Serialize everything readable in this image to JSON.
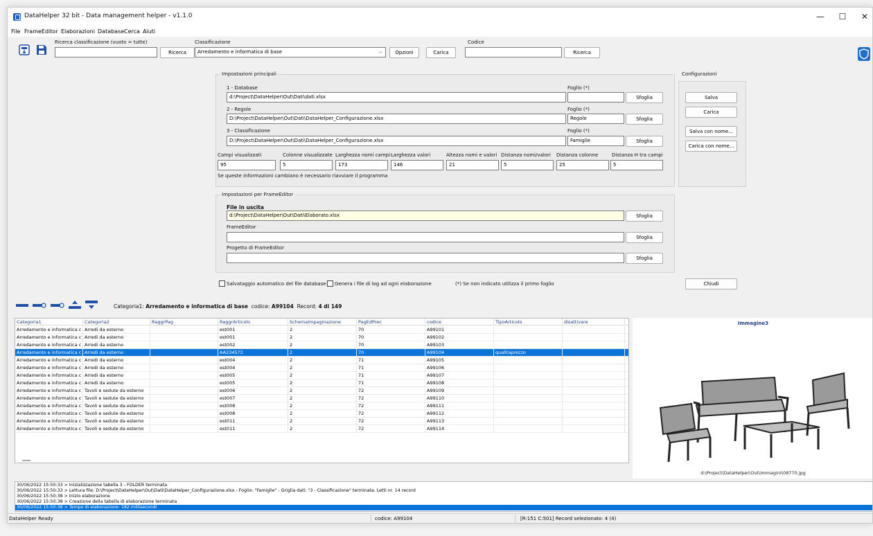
{
  "window": {
    "title": "DataHelper 32 bit - Data management helper - v1.1.0",
    "min": "—",
    "max": "☐",
    "close": "✕"
  },
  "menu": [
    "File",
    "FrameEditor",
    "Elaborazioni",
    "Database",
    "Cerca",
    "Aiuti"
  ],
  "search": {
    "class_label": "Ricerca classificazione (vuoto = tutte)",
    "class_value": "",
    "search_btn": "Ricerca",
    "classification_label": "Classificazione",
    "classification_value": "Arredamento e informatica di base",
    "options_btn": "Opzioni",
    "load_btn": "Carica",
    "code_label": "Codice",
    "code_value": "",
    "code_search_btn": "Ricerca"
  },
  "main_settings": {
    "title": "Impostazioni principali",
    "db_label": "1 - Database",
    "db_value": "d:\\Project\\DataHelper\\Out\\Dati\\dati.xlsx",
    "db_sheet": "",
    "rules_label": "2 - Regole",
    "rules_value": "D:\\Project\\DataHelper\\Out\\Dati\\DataHelper_Configurazione.xlsx",
    "rules_sheet": "Regole",
    "class_label": "3 - Classificazione",
    "class_value": "D:\\Project\\DataHelper\\Out\\Dati\\DataHelper_Configurazione.xlsx",
    "class_sheet": "Famiglie",
    "sheet_label": "Foglio (*)",
    "browse": "Sfoglia",
    "params": [
      {
        "label": "Campi visualizzati",
        "value": "95"
      },
      {
        "label": "Colonne visualizzate",
        "value": "5"
      },
      {
        "label": "Larghezza nomi campi",
        "value": "173"
      },
      {
        "label": "Larghezza valori",
        "value": "146"
      },
      {
        "label": "Altezza nomi e valori",
        "value": "21"
      },
      {
        "label": "Distanza nomi/valori",
        "value": "5"
      },
      {
        "label": "Distanza colonne",
        "value": "25"
      },
      {
        "label": "Distanza H tra campi",
        "value": "5"
      }
    ],
    "restart_note": "Se queste informazioni cambiano è necessario riavviare il programma"
  },
  "config": {
    "title": "Configurazioni",
    "save": "Salva",
    "load": "Carica",
    "save_as": "Salva con nome...",
    "load_as": "Carica con nome..."
  },
  "frameeditor": {
    "title": "Impostazioni per FrameEditor",
    "out_label": "File in uscita",
    "out_value": "d:\\Project\\DataHelper\\Out\\Dati\\Elaborato.xlsx",
    "fe_label": "FrameEditor",
    "fe_value": "",
    "proj_label": "Progetto di FrameEditor",
    "proj_value": "",
    "browse": "Sfoglia"
  },
  "options": {
    "autosave": "Salvataggio automatico del file database",
    "logfile": "Genera i file di log ad ogni elaborazione",
    "note": "(*) Se non indicato utilizza il primo foglio",
    "close_btn": "Chiudi"
  },
  "record_bar": {
    "cat_label": "Categoria1:",
    "cat_value": "Arredamento e informatica di base",
    "code_label": "codice:",
    "code_value": "A99104",
    "rec_label": "Record:",
    "rec_value": "4 di 149"
  },
  "grid": {
    "columns": [
      "Categoria1",
      "Categoria2",
      "RaggrPag",
      "RaggrArticolo",
      "SchemaImpaginazione",
      "PagEdPrec",
      "codice",
      "TipoArticolo",
      "disattivare"
    ],
    "rows": [
      [
        "Arredamento e informatica c",
        "Arredi da esterno",
        "",
        "est001",
        "2",
        "70",
        "A99101",
        "",
        ""
      ],
      [
        "Arredamento e informatica c",
        "Arredi da esterno",
        "",
        "est001",
        "2",
        "70",
        "A99102",
        "",
        ""
      ],
      [
        "Arredamento e informatica c",
        "Arredi da esterno",
        "",
        "est002",
        "2",
        "70",
        "A99103",
        "",
        ""
      ],
      [
        "Arredamento e informatica c",
        "Arredi da esterno",
        "",
        "AA2345?3",
        "2",
        "70",
        "A99104",
        "qualitaprezzo",
        ""
      ],
      [
        "Arredamento e informatica c",
        "Arredi da esterno",
        "",
        "est004",
        "2",
        "71",
        "A99105",
        "",
        ""
      ],
      [
        "Arredamento e informatica c",
        "Arredi da esterno",
        "",
        "est004",
        "2",
        "71",
        "A99106",
        "",
        ""
      ],
      [
        "Arredamento e informatica c",
        "Arredi da esterno",
        "",
        "est005",
        "2",
        "71",
        "A99107",
        "",
        ""
      ],
      [
        "Arredamento e informatica c",
        "Arredi da esterno",
        "",
        "est005",
        "2",
        "71",
        "A99108",
        "",
        ""
      ],
      [
        "Arredamento e informatica c",
        "Tavoli e sedute da esterno",
        "",
        "est006",
        "2",
        "72",
        "A99109",
        "",
        ""
      ],
      [
        "Arredamento e informatica c",
        "Tavoli e sedute da esterno",
        "",
        "est007",
        "2",
        "72",
        "A99110",
        "",
        ""
      ],
      [
        "Arredamento e informatica c",
        "Tavoli e sedute da esterno",
        "",
        "est008",
        "2",
        "72",
        "A99111",
        "",
        ""
      ],
      [
        "Arredamento e informatica c",
        "Tavoli e sedute da esterno",
        "",
        "est008",
        "2",
        "72",
        "A99112",
        "",
        ""
      ],
      [
        "Arredamento e informatica c",
        "Tavoli e sedute da esterno",
        "",
        "est011",
        "2",
        "72",
        "A99113",
        "",
        ""
      ],
      [
        "Arredamento e informatica c",
        "Tavoli e sedute da esterno",
        "",
        "est011",
        "2",
        "72",
        "A99114",
        "",
        ""
      ]
    ],
    "selected_row": 3
  },
  "image_panel": {
    "title": "Immagine3",
    "path": "d:\\Project\\DataHelper\\Out\\Immagini\\08770.jpg"
  },
  "log": [
    "30/06/2022 15:50:33 > Inizializzazione tabella 3 - FOLDER terminata",
    "30/06/2022 15:50:33 > Lettura file: D:\\Project\\DataHelper\\Out\\Dati\\DataHelper_Configurazione.xlsx - Foglio: \"Famiglie\" - Griglia dati: \"3 - Classificazione\" terminata. Letti nr. 14 record",
    "30/06/2022 15:50:38 > Inizio elaborazione",
    "30/06/2022 15:50:38 > Creazione della tabella di elaborazione terminata",
    "30/06/2022 15:50:38 > Tempo di elaborazione: 182 millisecondi"
  ],
  "status": {
    "ready": "DataHelper Ready",
    "code": "codice: A99104",
    "record": "[R:151 C:501] Record selezionato: 4 (4)"
  },
  "colors": {
    "accent": "#0a74d8",
    "header_text": "#1a3a8a",
    "yellow_field": "#ffffe6"
  }
}
